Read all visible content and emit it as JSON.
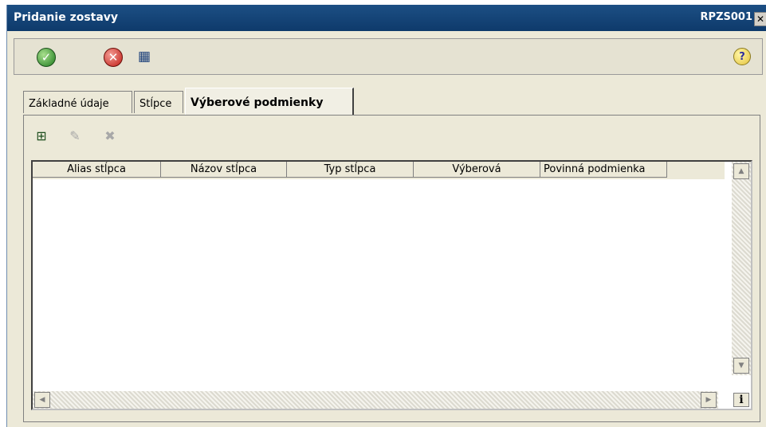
{
  "window": {
    "title": "Pridanie zostavy",
    "code": "RPZS001",
    "close_glyph": "✕"
  },
  "toolbar": {
    "ok_icon": "check-icon",
    "cancel_icon": "cancel-icon",
    "layout_icon": "layout-icon",
    "help_icon": "help-icon",
    "help_glyph": "?"
  },
  "tabs": [
    {
      "label": "Základné údaje",
      "active": false
    },
    {
      "label": "Stĺpce",
      "active": false
    },
    {
      "label": "Výberové podmienky",
      "active": true
    }
  ],
  "subtoolbar": {
    "add_icon": "add-icon",
    "edit_icon": "edit-icon",
    "delete_icon": "delete-icon"
  },
  "grid": {
    "columns": [
      "Alias stĺpca",
      "Názov stĺpca",
      "Typ stĺpca",
      "Výberová",
      "Povinná podmienka"
    ],
    "rows": [],
    "info_glyph": "i"
  }
}
